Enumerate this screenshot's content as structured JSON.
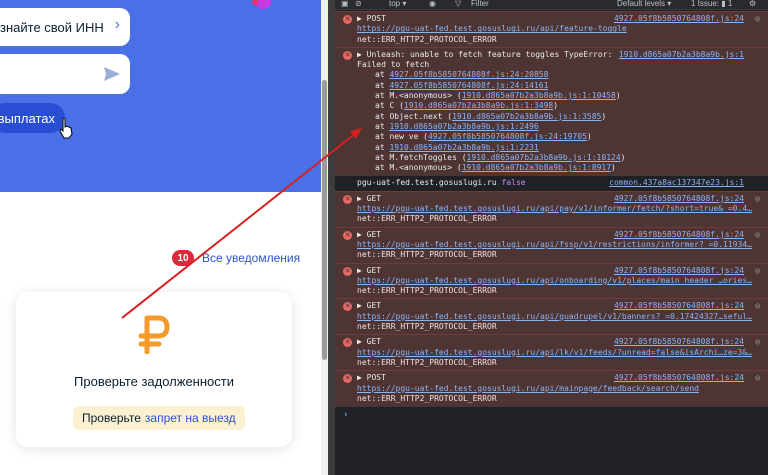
{
  "page": {
    "inn_chip": "знайте свой ИНН",
    "pill_button": "цвыплатах",
    "notifications": {
      "count": "10",
      "link": "Все уведомления"
    },
    "card": {
      "title": "Проверьте задолженности",
      "button_prefix": "Проверьте",
      "button_accent": "запрет на выезд"
    }
  },
  "devtools": {
    "toolbar": {
      "context": "top ▾",
      "filter": "Filter",
      "levels": "Default levels ▾",
      "issues": "1 Issue: ▮ 1"
    },
    "messages": [
      {
        "type": "error",
        "method": "▶ POST",
        "source": "4927.05f8b5850764808f.js:24",
        "url": "https://pgu-uat-fed.test.gosuslugi.ru/api/feature-toggle",
        "error": "net::ERR_HTTP2_PROTOCOL_ERROR"
      },
      {
        "type": "error-stack",
        "head": "▶ Unleash: unable to fetch feature toggles TypeError:",
        "source": "1910.d865a07b2a3b8a9b.js:1",
        "line2": "Failed to fetch",
        "stack": [
          {
            "prefix": "at ",
            "link": "4927.05f8b5850764808f.js:24:20858",
            "suffix": ""
          },
          {
            "prefix": "at ",
            "link": "4927.05f8b5850764808f.js:24:14161",
            "suffix": ""
          },
          {
            "prefix": "at M.<anonymous> (",
            "link": "1910.d865a07b2a3b8a9b.js:1:10458",
            "suffix": ")"
          },
          {
            "prefix": "at C (",
            "link": "1910.d865a07b2a3b8a9b.js:1:3498",
            "suffix": ")"
          },
          {
            "prefix": "at Object.next (",
            "link": "1910.d865a07b2a3b8a9b.js:1:3585",
            "suffix": ")"
          },
          {
            "prefix": "at ",
            "link": "1910.d865a07b2a3b8a9b.js:1:2496",
            "suffix": ""
          },
          {
            "prefix": "at new ve (",
            "link": "4927.05f8b5850764808f.js:24:19705",
            "suffix": ")"
          },
          {
            "prefix": "at ",
            "link": "1910.d865a07b2a3b8a9b.js:1:2231",
            "suffix": ""
          },
          {
            "prefix": "at M.fetchToggles (",
            "link": "1910.d865a07b2a3b8a9b.js:1:10124",
            "suffix": ")"
          },
          {
            "prefix": "at M.<anonymous> (",
            "link": "1910.d865a07b2a3b8a9b.js:1:8917",
            "suffix": ")"
          }
        ]
      },
      {
        "type": "info",
        "text": "pgu-uat-fed.test.gosuslugi.ru",
        "value": "false",
        "source": "common.437a8ac137347e23.js:1"
      },
      {
        "type": "error",
        "method": "▶ GET",
        "source": "4927.05f8b5850764808f.js:24",
        "url": "https://pgu-uat-fed.test.gosuslugi.ru/api/pay/v1/informer/fetch/?short=true& =0.4…",
        "error": "net::ERR_HTTP2_PROTOCOL_ERROR"
      },
      {
        "type": "error",
        "method": "▶ GET",
        "source": "4927.05f8b5850764808f.js:24",
        "url": "https://pgu-uat-fed.test.gosuslugi.ru/api/fssp/v1/restrictions/informer? =0.11934…",
        "error": "net::ERR_HTTP2_PROTOCOL_ERROR"
      },
      {
        "type": "error",
        "method": "▶ GET",
        "source": "4927.05f8b5850764808f.js:24",
        "url": "https://pgu-uat-fed.test.gosuslugi.ru/api/onboarding/v1/places/main_header_…ories…",
        "error": "net::ERR_HTTP2_PROTOCOL_ERROR"
      },
      {
        "type": "error",
        "method": "▶ GET",
        "source": "4927.05f8b5850764808f.js:24",
        "url": "https://pgu-uat-fed.test.gosuslugi.ru/api/guadrupel/v1/banners? =0.17424327…seful…",
        "error": "net::ERR_HTTP2_PROTOCOL_ERROR"
      },
      {
        "type": "error",
        "method": "▶ GET",
        "source": "4927.05f8b5850764808f.js:24",
        "url": "https://pgu-uat-fed.test.gosuslugi.ru/api/lk/v1/feeds/?unread=false&isArchi…ze=3&…",
        "error": "net::ERR_HTTP2_PROTOCOL_ERROR"
      },
      {
        "type": "error",
        "method": "▶ POST",
        "source": "4927.05f8b5850764808f.js:24",
        "url": "https://pgu-uat-fed.test.gosuslugi.ru/api/mainpage/feedback/search/send",
        "error": "net::ERR_HTTP2_PROTOCOL_ERROR"
      }
    ],
    "prompt": "›"
  },
  "colors": {
    "brand_blue": "#4a70e8",
    "error_bg": "#4e3534",
    "link": "#8ab4f8",
    "arrow": "#d62020"
  }
}
